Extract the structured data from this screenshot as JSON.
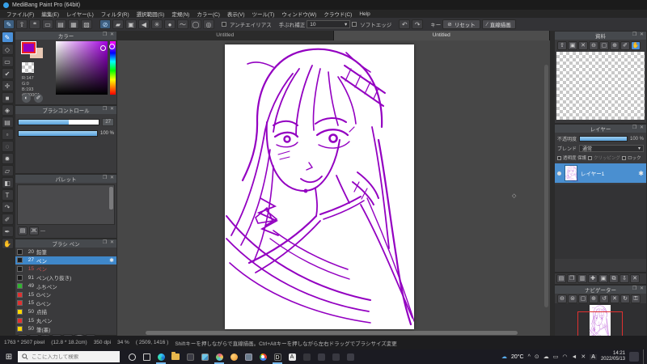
{
  "window": {
    "title": "MediBang Paint Pro (64bit)"
  },
  "menu": {
    "items": [
      "ファイル(F)",
      "編集(E)",
      "レイヤー(L)",
      "フィルタ(R)",
      "選択範囲(S)",
      "定規(N)",
      "カラー(C)",
      "表示(V)",
      "ツール(T)",
      "ウィンドウ(W)",
      "クラウド(C)",
      "Help"
    ]
  },
  "optionsbar": {
    "group1": [
      {
        "name": "cloud-save-icon",
        "glyph": "✎"
      },
      {
        "name": "export-icon",
        "glyph": "⇧"
      },
      {
        "name": "comment-icon",
        "glyph": "❝"
      },
      {
        "name": "message-icon",
        "glyph": "▭"
      },
      {
        "name": "file-icon",
        "glyph": "▤"
      },
      {
        "name": "grid-icon",
        "glyph": "▦"
      },
      {
        "name": "grid-edit-icon",
        "glyph": "▧"
      }
    ],
    "group2": [
      {
        "name": "no-correction-icon",
        "glyph": "⊘",
        "on": true
      },
      {
        "name": "brush-solid-icon",
        "glyph": "▰"
      },
      {
        "name": "brush-square-icon",
        "glyph": "▣"
      },
      {
        "name": "brush-triangle-icon",
        "glyph": "◀"
      },
      {
        "name": "brush-burst-icon",
        "glyph": "✳"
      },
      {
        "name": "brush-circle-icon",
        "glyph": "●"
      },
      {
        "name": "brush-curve-icon",
        "glyph": "〜"
      },
      {
        "name": "brush-ring-icon",
        "glyph": "◯"
      },
      {
        "name": "brush-double-ring-icon",
        "glyph": "◎"
      }
    ],
    "antialias_label": "アンチエイリアス",
    "stabilizer_label": "手ぶれ補正",
    "stabilizer_value": "10",
    "softedge_label": "ソフトエッジ",
    "undo_glyph": "↶",
    "redo_glyph": "↷",
    "key_label": "キー",
    "reset_label": "リセット",
    "reset_glyph": "⊘",
    "line_label": "直線描画",
    "line_glyph": "∕"
  },
  "tabs": [
    {
      "label": "Untitled"
    },
    {
      "label": "Untitled"
    }
  ],
  "tools": [
    {
      "name": "brush-tool",
      "glyph": "✎",
      "selected": true
    },
    {
      "name": "eraser-tool",
      "glyph": "◇"
    },
    {
      "name": "rect-tool",
      "glyph": "▭"
    },
    {
      "name": "select-pen-tool",
      "glyph": "✔"
    },
    {
      "name": "move-tool",
      "glyph": "✛"
    },
    {
      "name": "fill-rect-tool",
      "glyph": "■"
    },
    {
      "name": "bucket-tool",
      "glyph": "◈"
    },
    {
      "name": "gradient-tool",
      "glyph": "▤"
    },
    {
      "name": "select-rect-tool",
      "glyph": "▫"
    },
    {
      "name": "lasso-tool",
      "glyph": "◌"
    },
    {
      "name": "magic-wand-tool",
      "glyph": "✹"
    },
    {
      "name": "select-pen2-tool",
      "glyph": "▱"
    },
    {
      "name": "select-eraser-tool",
      "glyph": "◧"
    },
    {
      "name": "text-tool",
      "glyph": "T"
    },
    {
      "name": "rotate-tool",
      "glyph": "↷"
    },
    {
      "name": "pen-tool",
      "glyph": "✐"
    },
    {
      "name": "eyedropper-tool",
      "glyph": "✒"
    },
    {
      "name": "hand-tool",
      "glyph": "✋"
    }
  ],
  "color_panel": {
    "title": "カラー",
    "r": "R:147",
    "g": "G:0",
    "b": "B:193",
    "hex": "#9300C1",
    "fg_color": "#9300C1",
    "bg_color": "#e9c9b4",
    "btn1_glyph": "◐",
    "btn2_glyph": "✐"
  },
  "brush_control": {
    "title": "ブラシコントロール",
    "size_value": "27",
    "size_pct": 0.62,
    "opacity_value": "100 %",
    "opacity_pct": 1
  },
  "palette_panel": {
    "title": "パレット",
    "new_glyph": "▤",
    "trash_glyph": "🝪",
    "dash": "—"
  },
  "brush_panel": {
    "title": "ブラシ ペン",
    "brushes": [
      {
        "size": "20",
        "name": "鉛筆",
        "swatch": "#1a1a1a"
      },
      {
        "size": "27",
        "name": "ペン",
        "swatch": "#1a1a1a",
        "selected": true,
        "gear": "✱"
      },
      {
        "size": "15",
        "name": "ペン",
        "swatch": "#1a1a1a",
        "red": true
      },
      {
        "size": "91",
        "name": "ペン(入り抜き)",
        "swatch": "#1a1a1a"
      },
      {
        "size": "49",
        "name": "ふちペン",
        "swatch": "#2fb52f"
      },
      {
        "size": "15",
        "name": "Gペン",
        "swatch": "#e03030"
      },
      {
        "size": "15",
        "name": "Gペン",
        "swatch": "#e03030"
      },
      {
        "size": "50",
        "name": "点描",
        "swatch": "#ffd800"
      },
      {
        "size": "15",
        "name": "丸ペン",
        "swatch": "#e03030"
      },
      {
        "size": "50",
        "name": "筆(墨)",
        "swatch": "#ffd800"
      }
    ],
    "footer_icons": [
      {
        "name": "upload-brush-icon",
        "glyph": "⇧"
      },
      {
        "name": "new-brush-icon",
        "glyph": "▤"
      },
      {
        "name": "add-brush-icon",
        "glyph": "✚"
      },
      {
        "name": "edit-brush-icon",
        "glyph": "✎"
      },
      {
        "name": "brush-folder-icon",
        "glyph": "▣"
      },
      {
        "name": "copy-brush-icon",
        "glyph": "❐"
      },
      {
        "name": "delete-brush-icon",
        "glyph": "✕"
      }
    ]
  },
  "materials_panel": {
    "title": "資料",
    "icons": [
      {
        "name": "import-material-icon",
        "glyph": "⇧"
      },
      {
        "name": "material-folder-icon",
        "glyph": "▣"
      },
      {
        "name": "close-material-icon",
        "glyph": "✕"
      },
      {
        "name": "zoom-out-icon",
        "glyph": "⊖"
      },
      {
        "name": "fit-view-icon",
        "glyph": "▢"
      },
      {
        "name": "zoom-in-icon",
        "glyph": "⊕"
      },
      {
        "name": "material-pen-icon",
        "glyph": "✐"
      },
      {
        "name": "material-hand-icon",
        "glyph": "✋",
        "on": true
      }
    ]
  },
  "layers_panel": {
    "title": "レイヤー",
    "opacity_label": "不透明度",
    "opacity_value": "100 %",
    "blend_label": "ブレンド",
    "blend_value": "通常",
    "protect_label": "透明度 保護",
    "clip_label": "クリッピング",
    "lock_label": "ロック",
    "layer_name": "レイヤー1",
    "gear_glyph": "✱",
    "footer_icons": [
      {
        "name": "new-layer-icon",
        "glyph": "▤"
      },
      {
        "name": "duplicate-layer-icon",
        "glyph": "❐"
      },
      {
        "name": "new-layer2-icon",
        "glyph": "▥"
      },
      {
        "name": "add-layer-icon",
        "glyph": "✚"
      },
      {
        "name": "layer-folder-icon",
        "glyph": "▣"
      },
      {
        "name": "copy-layer-icon",
        "glyph": "⧉"
      },
      {
        "name": "merge-layer-icon",
        "glyph": "⇩"
      },
      {
        "name": "delete-layer-icon",
        "glyph": "✕"
      }
    ]
  },
  "navigator_panel": {
    "title": "ナビゲーター",
    "icons": [
      {
        "name": "nav-zoom-out-icon",
        "glyph": "⊖"
      },
      {
        "name": "nav-zoom-reset-icon",
        "glyph": "⊜"
      },
      {
        "name": "nav-fit-icon",
        "glyph": "▢"
      },
      {
        "name": "nav-zoom-in-icon",
        "glyph": "⊕"
      },
      {
        "name": "nav-rotate-left-icon",
        "glyph": "↺"
      },
      {
        "name": "nav-rotate-reset-icon",
        "glyph": "✕"
      },
      {
        "name": "nav-rotate-right-icon",
        "glyph": "↻"
      },
      {
        "name": "nav-lock-icon",
        "glyph": "⚿"
      }
    ]
  },
  "panel_buttons": {
    "popout_glyph": "❐",
    "close_glyph": "✕"
  },
  "statusbar": {
    "dimensions": "1763 * 2507 pixel",
    "size_cm": "(12.8 * 18.2cm)",
    "dpi": "350 dpi",
    "zoom": "34 %",
    "coords": "( 2509, 1416 )",
    "hint": "Shiftキーを押しながらで直線描画。Ctrl+Altキーを押しながら左右ドラッグでブラシサイズ変更"
  },
  "taskbar": {
    "search_placeholder": "ここに入力して検索",
    "temp": "20°C",
    "weather_glyph": "☁",
    "caret": "^",
    "time": "14:21",
    "date": "2022/05/13",
    "ime": "A",
    "tray_glyphs": [
      "⊙",
      "☁",
      "▭",
      "◠",
      "◄",
      "✕"
    ]
  },
  "colors": {
    "accent": "#4a90d9",
    "selection": "#3f87c9",
    "purple": "#9300C1",
    "navrect": "#e03030"
  }
}
